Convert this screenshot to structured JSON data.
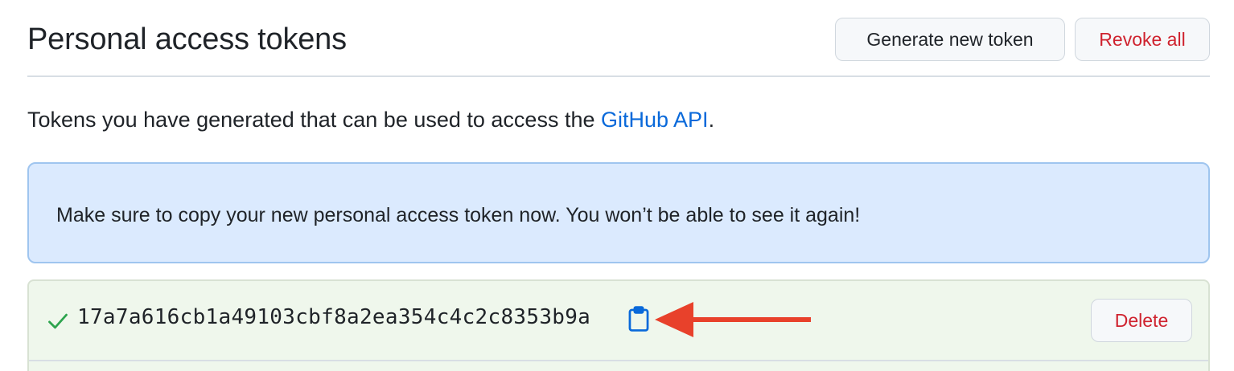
{
  "header": {
    "title": "Personal access tokens",
    "generate_label": "Generate new token",
    "revoke_label": "Revoke all"
  },
  "description": {
    "text_before": "Tokens you have generated that can be used to access the ",
    "link_text": "GitHub API",
    "text_after": "."
  },
  "flash": {
    "message": "Make sure to copy your new personal access token now. You won’t be able to see it again!"
  },
  "token": {
    "value": "17a7a616cb1a49103cbf8a2ea354c4c2c8353b9a",
    "status_icon": "check-icon",
    "copy_icon": "clipboard-icon",
    "delete_label": "Delete"
  },
  "annotation": {
    "arrow_color": "#e8412b"
  },
  "colors": {
    "link": "#0969da",
    "danger": "#cf222e",
    "success": "#2da44e",
    "flash_bg": "#dbeafe",
    "token_bg": "#eff7ec"
  }
}
